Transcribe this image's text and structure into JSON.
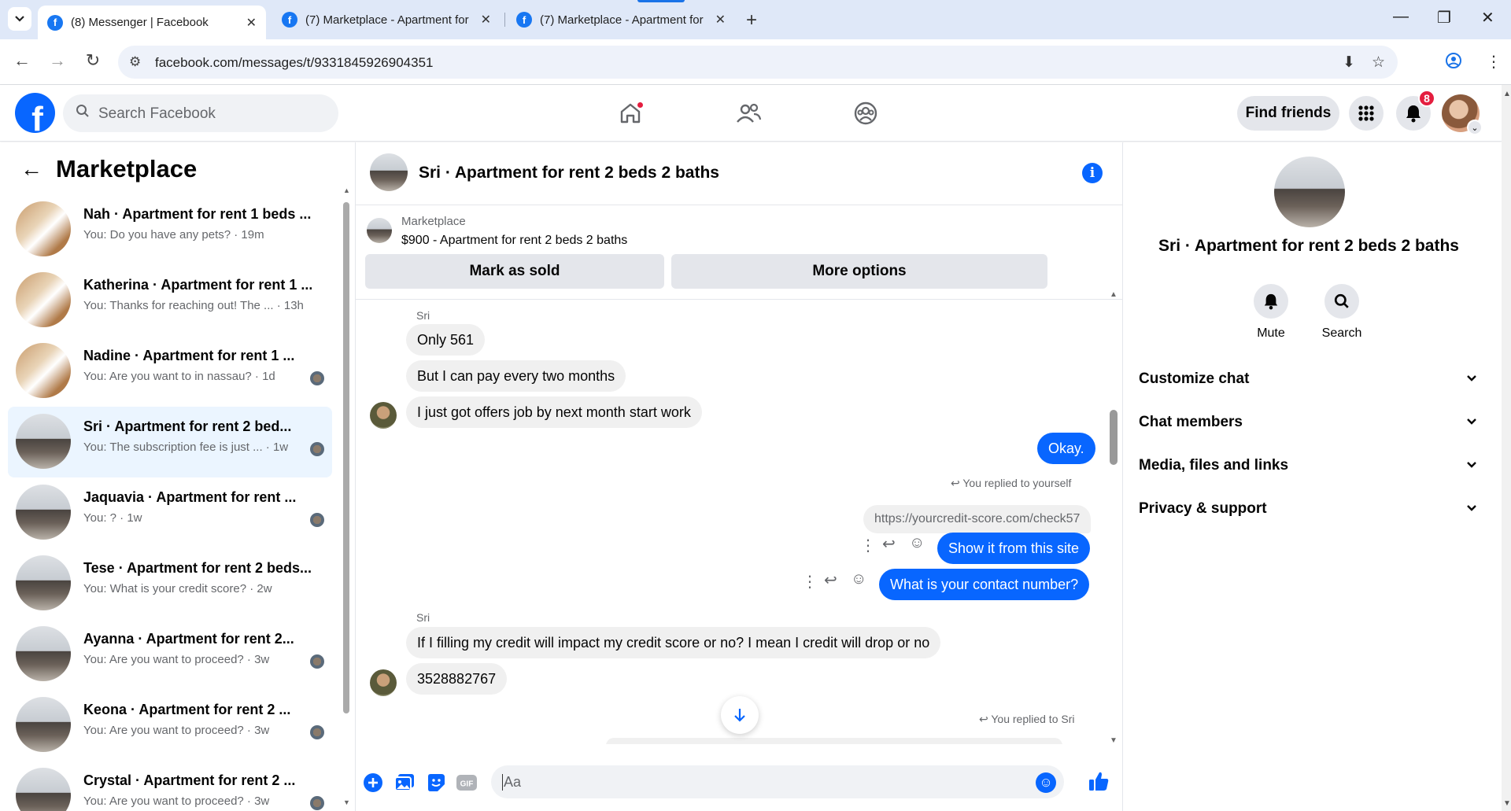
{
  "browser": {
    "tabs": [
      {
        "title": "(8) Messenger | Facebook"
      },
      {
        "title": "(7) Marketplace - Apartment for"
      },
      {
        "title": "(7) Marketplace - Apartment for"
      }
    ],
    "url": "facebook.com/messages/t/9331845926904351"
  },
  "header": {
    "search_placeholder": "Search Facebook",
    "find_friends": "Find friends",
    "notification_count": "8"
  },
  "sidebar": {
    "title": "Marketplace",
    "conversations": [
      {
        "name": "Nah · Apartment for rent 1 beds ...",
        "snippet": "You: Do you have any pets? · 19m",
        "thumb": "wood",
        "selected": false,
        "seen": false
      },
      {
        "name": "Katherina · Apartment for rent 1 ...",
        "snippet": "You: Thanks for reaching out! The ... · 13h",
        "thumb": "wood",
        "selected": false,
        "seen": false
      },
      {
        "name": "Nadine · Apartment for rent 1 ...",
        "snippet": "You: Are you want to in nassau? · 1d",
        "thumb": "wood",
        "selected": false,
        "seen": true
      },
      {
        "name": "Sri · Apartment for rent 2 bed...",
        "snippet": "You: The subscription fee is just ... · 1w",
        "thumb": "grey",
        "selected": true,
        "seen": true
      },
      {
        "name": "Jaquavia · Apartment for rent ...",
        "snippet": "You: ? · 1w",
        "thumb": "grey",
        "selected": false,
        "seen": true
      },
      {
        "name": "Tese · Apartment for rent 2 beds...",
        "snippet": "You: What is your credit score? · 2w",
        "thumb": "grey",
        "selected": false,
        "seen": false
      },
      {
        "name": "Ayanna · Apartment for rent 2...",
        "snippet": "You: Are you want to proceed? · 3w",
        "thumb": "grey",
        "selected": false,
        "seen": true
      },
      {
        "name": "Keona · Apartment for rent 2 ...",
        "snippet": "You: Are you want to proceed? · 3w",
        "thumb": "grey",
        "selected": false,
        "seen": true
      },
      {
        "name": "Crystal · Apartment for rent 2 ...",
        "snippet": "You: Are you want to proceed? · 3w",
        "thumb": "grey",
        "selected": false,
        "seen": true
      }
    ]
  },
  "chat": {
    "title": "Sri · Apartment for rent 2 beds 2 baths",
    "listing": {
      "source": "Marketplace",
      "price_title": "$900 - Apartment for rent 2 beds 2 baths",
      "mark_sold": "Mark as sold",
      "more_options": "More options"
    },
    "messages": {
      "sender_1": "Sri",
      "m1": "Only 561",
      "m2": "But I can pay every two months",
      "m3": "I just got offers job by next month start work",
      "m4": "Okay.",
      "replied_self": "You replied to yourself",
      "quoted_link": "https://yourcredit-score.com/check57",
      "m5": "Show it from this site",
      "m6": "What is your contact number?",
      "sender_2": "Sri",
      "m7": "If I filling my credit will impact my credit score or no? I mean I credit will drop or no",
      "m8": "3528882767",
      "replied_sri": "You replied to Sri"
    },
    "composer_placeholder": "Aa"
  },
  "details": {
    "title": "Sri · Apartment for rent 2 beds 2 baths",
    "mute": "Mute",
    "search": "Search",
    "sections": [
      "Customize chat",
      "Chat members",
      "Media, files and links",
      "Privacy & support"
    ]
  },
  "colors": {
    "accent": "#0866ff",
    "badge": "#e41e3f",
    "selected_row": "#ebf5ff"
  }
}
